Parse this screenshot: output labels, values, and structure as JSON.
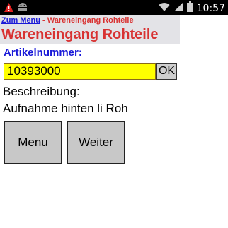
{
  "status_bar": {
    "time": "10:57",
    "icons": [
      "warning-icon",
      "android-icon",
      "wifi-icon",
      "signal-icon",
      "battery-icon"
    ]
  },
  "breadcrumb": {
    "link": "Zum Menu",
    "separator": " - ",
    "current": "Wareneingang Rohteile"
  },
  "page_title": "Wareneingang Rohteile",
  "form": {
    "article_label": "Artikelnummer:",
    "article_value": "10393000",
    "ok_label": "OK",
    "description_label": "Beschreibung:",
    "description_value": "Aufnahme hinten li Roh"
  },
  "buttons": {
    "menu": "Menu",
    "next": "Weiter"
  },
  "colors": {
    "link_blue": "#1a1ad8",
    "title_red": "#d83232",
    "input_yellow": "#ffff00",
    "button_gray": "#c8c8c8",
    "header_band": "#e3e3e7"
  }
}
